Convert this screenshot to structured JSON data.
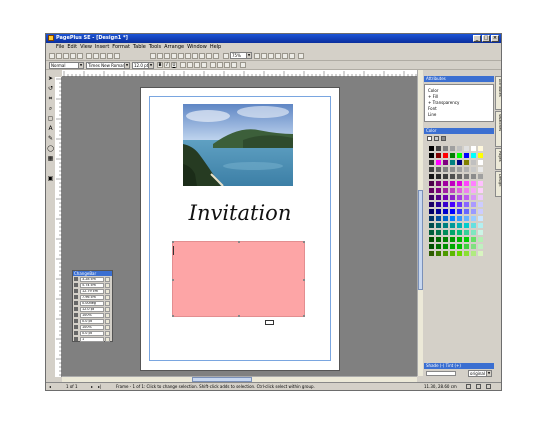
{
  "window": {
    "title": "PagePlus SE - [Design1 *]",
    "minimize": "_",
    "maximize": "□",
    "close": "×"
  },
  "menu": [
    "File",
    "Edit",
    "View",
    "Insert",
    "Format",
    "Table",
    "Tools",
    "Arrange",
    "Window",
    "Help"
  ],
  "toolbar": {
    "zoom": "75%",
    "style": "Normal",
    "font": "Times New Roman",
    "size": "12.0 pt",
    "bold": "B",
    "italic": "I",
    "underline": "U"
  },
  "page": {
    "heading": "Invitation"
  },
  "changebar": {
    "title": "ChangeBar",
    "rows": [
      "3.28 cm",
      "5.74 cm",
      "12.79 cm",
      "7.96 cm",
      "0.00deg",
      "12.0 pt",
      "100%",
      "0.0 pt",
      "100%",
      "0.0 pt",
      "1"
    ]
  },
  "attributes": {
    "title": "Attributes",
    "items": [
      "Color",
      "Fill",
      "Transparency",
      "Font",
      "Line"
    ]
  },
  "color": {
    "title": "Color",
    "footer": "Shade (-) Tint (+)",
    "mode": "original",
    "swatches": [
      "#000000",
      "#404040",
      "#808080",
      "#a0a0a0",
      "#c0c0c0",
      "#e0e0e0",
      "#ffffff",
      "#fff8dc",
      "#000000",
      "#800000",
      "#ff0000",
      "#008000",
      "#00ff00",
      "#0000ff",
      "#00ffff",
      "#ffff00",
      "#333333",
      "#ff00ff",
      "#800080",
      "#008080",
      "#000080",
      "#808000",
      "#c0c0c0",
      "#ffffff",
      "#404040",
      "#606060",
      "#808080",
      "#909090",
      "#a0a0a0",
      "#b0b0b0",
      "#c8c8c8",
      "#e8e8e8",
      "#141414",
      "#282828",
      "#3c3c3c",
      "#505050",
      "#646464",
      "#787878",
      "#8c8c8c",
      "#a0a0a0",
      "#4b0049",
      "#7a0075",
      "#a000a0",
      "#c000c0",
      "#e000e0",
      "#ff40ff",
      "#ff80ff",
      "#ffc0ff",
      "#600060",
      "#800080",
      "#a020a0",
      "#c040c0",
      "#e060e0",
      "#f080f0",
      "#f8a8f8",
      "#fcd0fc",
      "#3a0060",
      "#550088",
      "#7000b0",
      "#8c20c8",
      "#a840e0",
      "#c060f0",
      "#d898f8",
      "#ecc8fc",
      "#1a0066",
      "#280099",
      "#3800cc",
      "#4800ff",
      "#6633ff",
      "#8866ff",
      "#aa99ff",
      "#ccccff",
      "#000066",
      "#000099",
      "#0000cc",
      "#0000ff",
      "#3333ff",
      "#6666ff",
      "#9999ff",
      "#ccccff",
      "#003366",
      "#004c99",
      "#0066cc",
      "#0080ff",
      "#3399ff",
      "#66b3ff",
      "#99ccff",
      "#cce6ff",
      "#004d4d",
      "#006666",
      "#008080",
      "#009999",
      "#00b3b3",
      "#00cccc",
      "#66e0e0",
      "#b3f0f0",
      "#005c3a",
      "#00734a",
      "#008c5a",
      "#00a66b",
      "#00bf7c",
      "#33d199",
      "#80e6c0",
      "#ccf5e6",
      "#004d00",
      "#006600",
      "#008000",
      "#009900",
      "#00b300",
      "#00cc00",
      "#66e066",
      "#b3f0b3",
      "#005000",
      "#007000",
      "#009000",
      "#00a800",
      "#00c000",
      "#40d040",
      "#80e080",
      "#c0f0c0",
      "#2e5c00",
      "#3d7a00",
      "#4c9900",
      "#5cb800",
      "#6bd600",
      "#8be033",
      "#b0eb80",
      "#d8f5c0"
    ]
  },
  "sidetabs": [
    "Attributes",
    "Swatches",
    "Pages",
    "Design"
  ],
  "status": {
    "page": "1 of 1",
    "message": "Frame - 1 of 1: Click to change selection. Shift-click adds to selection. Ctrl-click select within group.",
    "coords": "11.30, 28.60 cm"
  }
}
